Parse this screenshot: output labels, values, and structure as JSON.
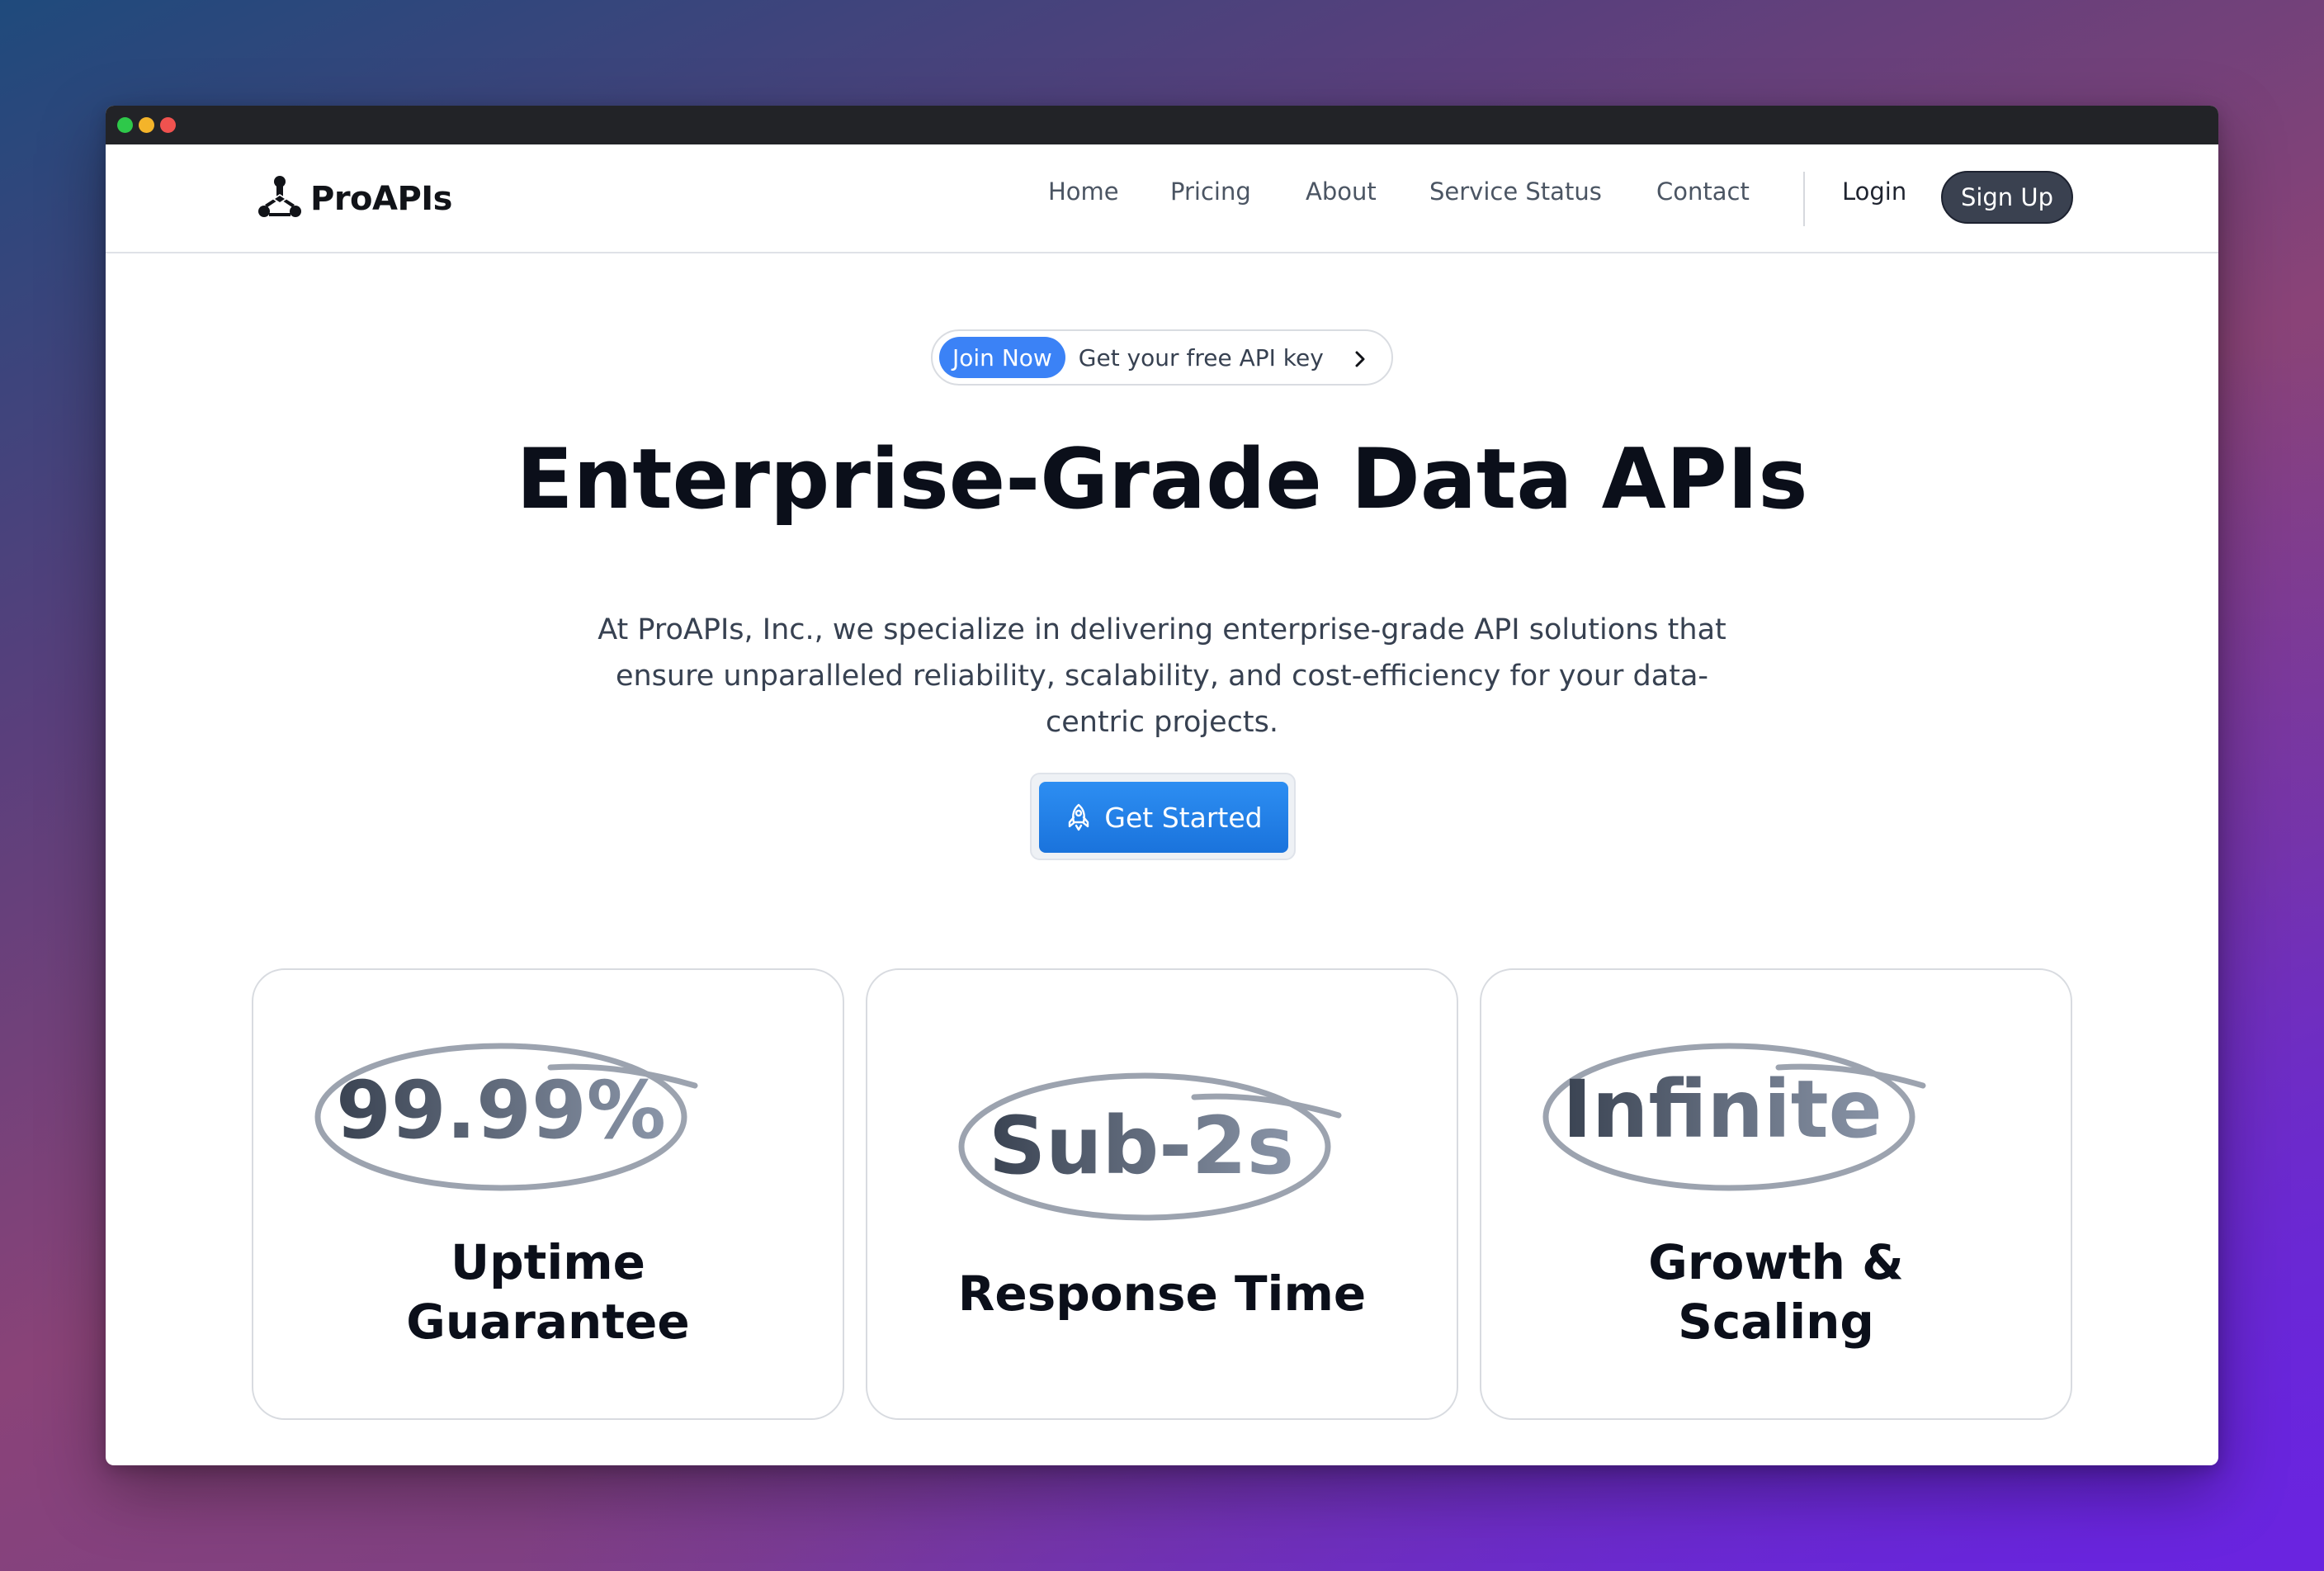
{
  "brand": {
    "name": "ProAPIs",
    "logo_icon": "triangle-node-logo"
  },
  "nav": {
    "links": [
      {
        "label": "Home"
      },
      {
        "label": "Pricing"
      },
      {
        "label": "About"
      },
      {
        "label": "Service Status"
      },
      {
        "label": "Contact"
      }
    ],
    "login_label": "Login",
    "signup_label": "Sign Up"
  },
  "announcement": {
    "badge": "Join Now",
    "text": "Get your free API key",
    "icon": "chevron-right-icon"
  },
  "hero": {
    "title": "Enterprise-Grade Data APIs",
    "description": "At ProAPIs, Inc., we specialize in delivering enterprise-grade API solutions that ensure unparalleled reliability, scalability, and cost-efficiency for your data-centric projects.",
    "cta_label": "Get Started",
    "cta_icon": "rocket-icon"
  },
  "features": [
    {
      "stat": "99.99%",
      "label": "Uptime Guarantee"
    },
    {
      "stat": "Sub-2s",
      "label": "Response Time"
    },
    {
      "stat": "Infinite",
      "label": "Growth & Scaling"
    }
  ],
  "colors": {
    "accent_blue": "#3b82f6",
    "cta_blue": "#1a73dc",
    "signup_dark": "#3a4150",
    "stat_gradient_start": "#3a4352",
    "stat_gradient_end": "#8a95a8",
    "oval_stroke": "#9ca3af"
  }
}
